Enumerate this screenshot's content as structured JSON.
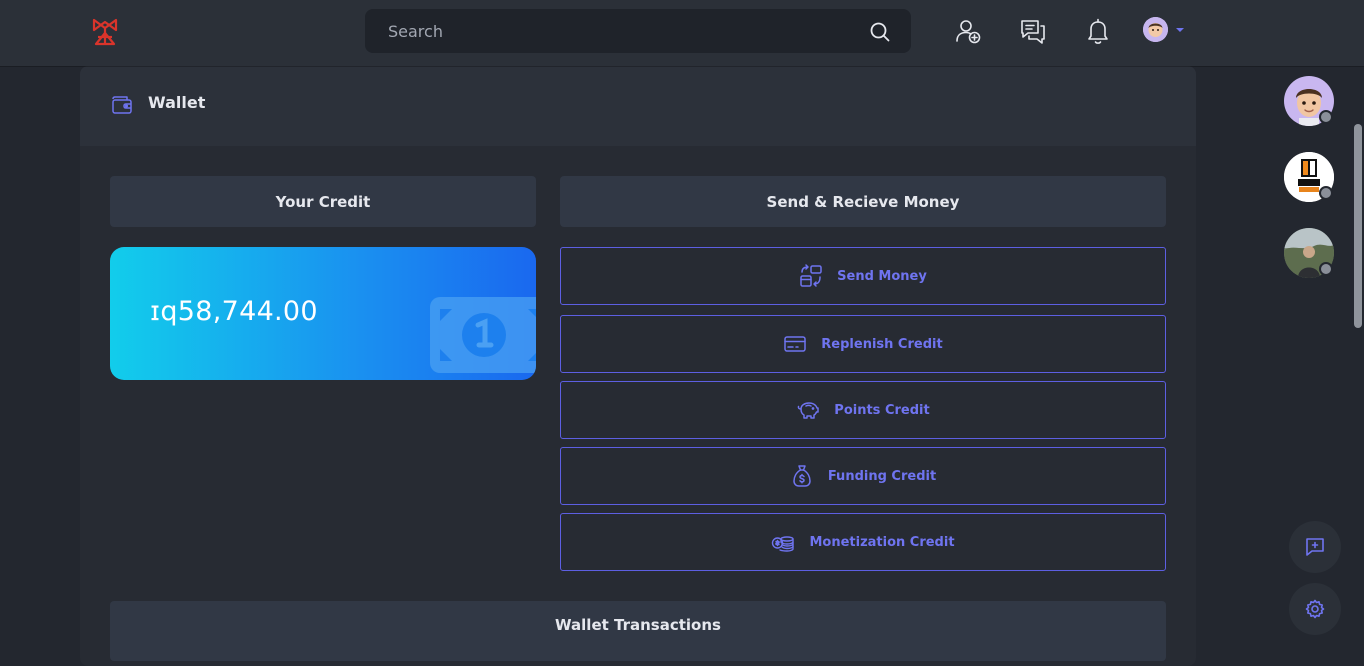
{
  "header": {
    "logo": "brand-logo",
    "search": {
      "placeholder": "Search",
      "value": ""
    },
    "icons": [
      "add-friend-icon",
      "messages-icon",
      "notifications-icon"
    ]
  },
  "wallet": {
    "title": "Wallet",
    "your_credit": {
      "heading": "Your Credit",
      "amount": "ɪq58,744.00"
    },
    "send_receive": {
      "heading": "Send & Recieve Money",
      "actions": [
        {
          "label": "Send Money",
          "icon": "transfer-icon"
        },
        {
          "label": "Replenish Credit",
          "icon": "credit-card-icon"
        },
        {
          "label": "Points Credit",
          "icon": "piggy-bank-icon"
        },
        {
          "label": "Funding Credit",
          "icon": "money-bag-icon"
        },
        {
          "label": "Monetization Credit",
          "icon": "coins-icon"
        }
      ]
    },
    "transactions": {
      "heading": "Wallet Transactions"
    }
  },
  "sidebar": {
    "avatars": [
      {
        "name": "user-avatar-memoji",
        "status": "offline"
      },
      {
        "name": "film-depot-avatar",
        "logo_text": "FILM DEPOT",
        "status": "offline"
      },
      {
        "name": "user-avatar-photo",
        "status": "offline"
      }
    ],
    "floating_buttons": [
      "new-chat-icon",
      "settings-gear-icon"
    ]
  },
  "colors": {
    "background": "#23272f",
    "surface": "#2b3038",
    "accent": "#5d5fe2",
    "card_gradient_start": "#12cdeb",
    "card_gradient_end": "#1a68ef",
    "logo_red": "#d9342b"
  }
}
